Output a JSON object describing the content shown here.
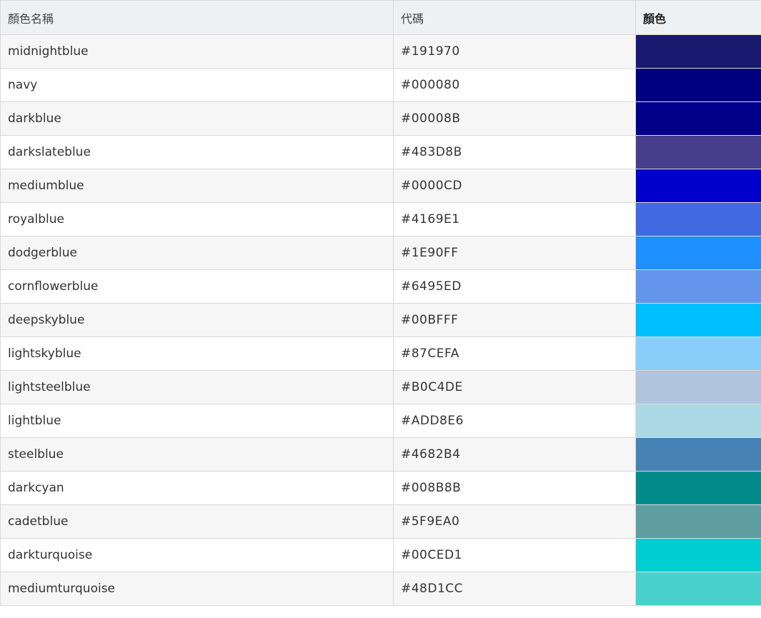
{
  "table": {
    "headers": {
      "name": "顏色名稱",
      "code": "代碼",
      "swatch": "顏色"
    },
    "rows": [
      {
        "name": "midnightblue",
        "code": "#191970",
        "color": "#191970"
      },
      {
        "name": "navy",
        "code": "#000080",
        "color": "#000080"
      },
      {
        "name": "darkblue",
        "code": "#00008B",
        "color": "#00008B"
      },
      {
        "name": "darkslateblue",
        "code": "#483D8B",
        "color": "#483D8B"
      },
      {
        "name": "mediumblue",
        "code": "#0000CD",
        "color": "#0000CD"
      },
      {
        "name": "royalblue",
        "code": "#4169E1",
        "color": "#4169E1"
      },
      {
        "name": "dodgerblue",
        "code": "#1E90FF",
        "color": "#1E90FF"
      },
      {
        "name": "cornflowerblue",
        "code": "#6495ED",
        "color": "#6495ED"
      },
      {
        "name": "deepskyblue",
        "code": "#00BFFF",
        "color": "#00BFFF"
      },
      {
        "name": "lightskyblue",
        "code": "#87CEFA",
        "color": "#87CEFA"
      },
      {
        "name": "lightsteelblue",
        "code": "#B0C4DE",
        "color": "#B0C4DE"
      },
      {
        "name": "lightblue",
        "code": "#ADD8E6",
        "color": "#ADD8E6"
      },
      {
        "name": "steelblue",
        "code": "#4682B4",
        "color": "#4682B4"
      },
      {
        "name": "darkcyan",
        "code": "#008B8B",
        "color": "#008B8B"
      },
      {
        "name": "cadetblue",
        "code": "#5F9EA0",
        "color": "#5F9EA0"
      },
      {
        "name": "darkturquoise",
        "code": "#00CED1",
        "color": "#00CED1"
      },
      {
        "name": "mediumturquoise",
        "code": "#48D1CC",
        "color": "#48D1CC"
      }
    ]
  }
}
